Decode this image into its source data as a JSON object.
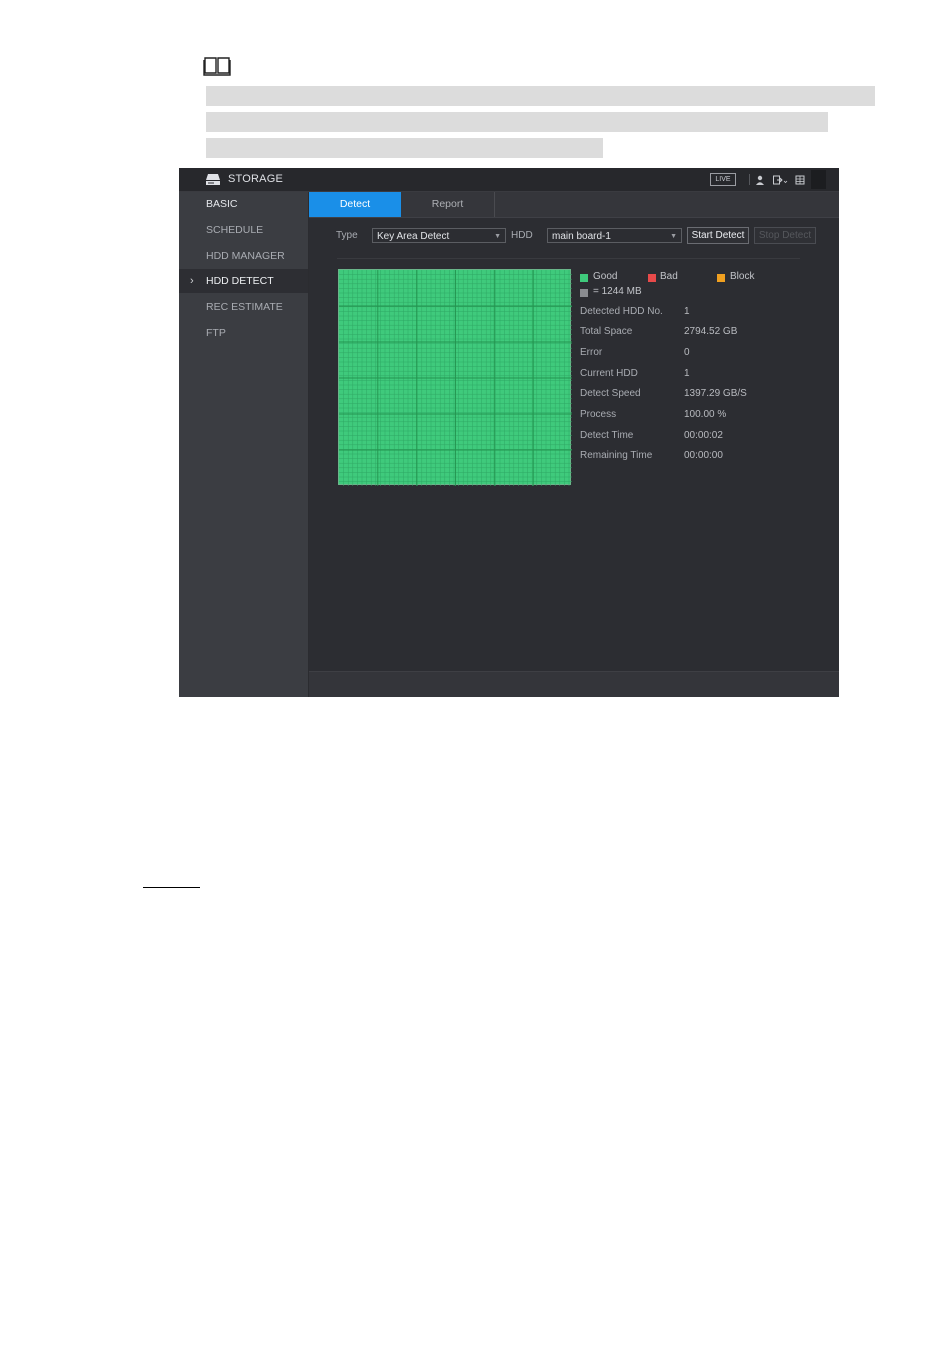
{
  "window": {
    "title": "STORAGE",
    "live_label": "LIVE"
  },
  "sidebar": {
    "items": [
      {
        "label": "BASIC"
      },
      {
        "label": "SCHEDULE"
      },
      {
        "label": "HDD MANAGER"
      },
      {
        "label": "HDD DETECT"
      },
      {
        "label": "REC ESTIMATE"
      },
      {
        "label": "FTP"
      }
    ],
    "active_chevron": "›"
  },
  "tabs": [
    {
      "label": "Detect"
    },
    {
      "label": "Report"
    }
  ],
  "controls": {
    "type_label": "Type",
    "type_value": "Key Area Detect",
    "hdd_label": "HDD",
    "hdd_value": "main board-1",
    "start_button": "Start Detect",
    "stop_button": "Stop Detect"
  },
  "legend": {
    "good": "Good",
    "bad": "Bad",
    "block": "Block",
    "unit": "= 1244 MB",
    "colors": {
      "good": "#3fca7c",
      "bad": "#e84a4a",
      "block": "#f0a020",
      "unit": "#8a8c90"
    }
  },
  "info": [
    {
      "label": "Detected HDD No.",
      "value": "1"
    },
    {
      "label": "Total Space",
      "value": "2794.52 GB"
    },
    {
      "label": "Error",
      "value": "0"
    },
    {
      "label": "Current HDD",
      "value": "1"
    },
    {
      "label": "Detect Speed",
      "value": "1397.29 GB/S"
    },
    {
      "label": "Process",
      "value": "100.00 %"
    },
    {
      "label": "Detect Time",
      "value": "00:00:02"
    },
    {
      "label": "Remaining Time",
      "value": "00:00:00"
    }
  ]
}
